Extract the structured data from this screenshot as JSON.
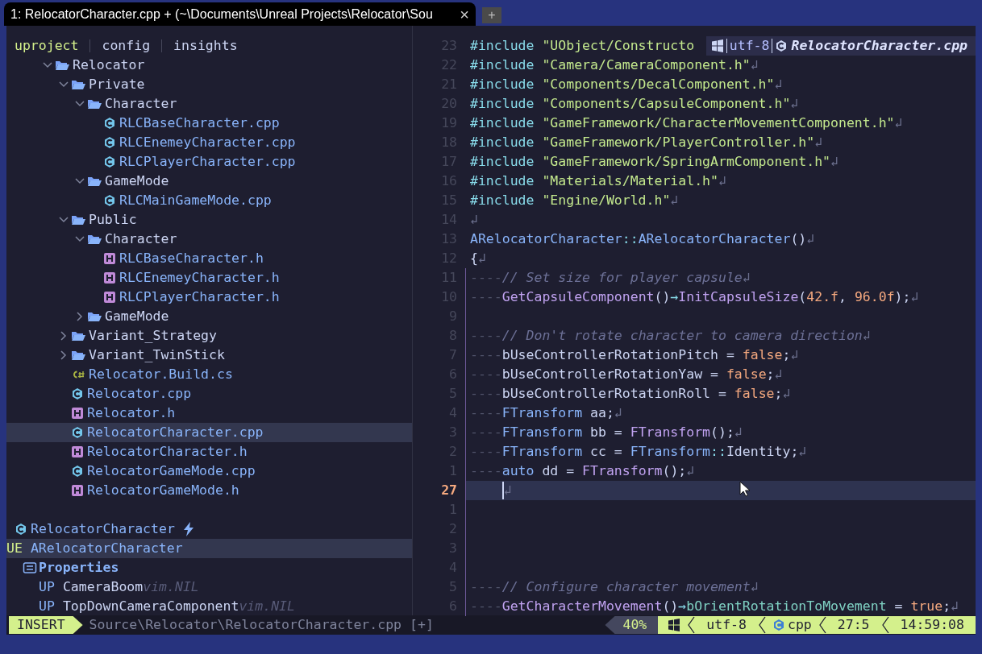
{
  "tab": {
    "title": "1: RelocatorCharacter.cpp + (~\\Documents\\Unreal Projects\\Relocator\\Sou",
    "close": "×",
    "new_tab": "+"
  },
  "explorer": {
    "tabs": [
      {
        "label": "uproject",
        "selected": true
      },
      {
        "label": "config",
        "selected": false
      },
      {
        "label": "insights",
        "selected": false
      }
    ],
    "tree": [
      {
        "name": "Relocator",
        "kind": "folder",
        "expanded": true,
        "selected": false,
        "children": [
          {
            "name": "Private",
            "kind": "folder",
            "expanded": true,
            "selected": false,
            "children": [
              {
                "name": "Character",
                "kind": "folder",
                "expanded": true,
                "selected": false,
                "children": [
                  {
                    "name": "RLCBaseCharacter.cpp",
                    "kind": "cpp",
                    "selected": false
                  },
                  {
                    "name": "RLCEnemeyCharacter.cpp",
                    "kind": "cpp",
                    "selected": false
                  },
                  {
                    "name": "RLCPlayerCharacter.cpp",
                    "kind": "cpp",
                    "selected": false
                  }
                ]
              },
              {
                "name": "GameMode",
                "kind": "folder",
                "expanded": true,
                "selected": false,
                "children": [
                  {
                    "name": "RLCMainGameMode.cpp",
                    "kind": "cpp",
                    "selected": false
                  }
                ]
              }
            ]
          },
          {
            "name": "Public",
            "kind": "folder",
            "expanded": true,
            "selected": false,
            "children": [
              {
                "name": "Character",
                "kind": "folder",
                "expanded": true,
                "selected": false,
                "children": [
                  {
                    "name": "RLCBaseCharacter.h",
                    "kind": "h",
                    "selected": false
                  },
                  {
                    "name": "RLCEnemeyCharacter.h",
                    "kind": "h",
                    "selected": false
                  },
                  {
                    "name": "RLCPlayerCharacter.h",
                    "kind": "h",
                    "selected": false
                  }
                ]
              },
              {
                "name": "GameMode",
                "kind": "folder",
                "expanded": false,
                "selected": false
              }
            ]
          },
          {
            "name": "Variant_Strategy",
            "kind": "folder",
            "expanded": false,
            "selected": false
          },
          {
            "name": "Variant_TwinStick",
            "kind": "folder",
            "expanded": false,
            "selected": false
          },
          {
            "name": "Relocator.Build.cs",
            "kind": "cs",
            "selected": false
          },
          {
            "name": "Relocator.cpp",
            "kind": "cpp",
            "selected": false
          },
          {
            "name": "Relocator.h",
            "kind": "h",
            "selected": false
          },
          {
            "name": "RelocatorCharacter.cpp",
            "kind": "cpp",
            "selected": true
          },
          {
            "name": "RelocatorCharacter.h",
            "kind": "h",
            "selected": false
          },
          {
            "name": "RelocatorGameMode.cpp",
            "kind": "cpp",
            "selected": false
          },
          {
            "name": "RelocatorGameMode.h",
            "kind": "h",
            "selected": false
          }
        ]
      }
    ]
  },
  "outline": {
    "title": "RelocatorCharacter",
    "items": [
      {
        "prefix": "UE",
        "name": "ARelocatorCharacter",
        "kind": "class",
        "selected": true,
        "children": [
          {
            "name": "Properties",
            "kind": "group",
            "selected": false,
            "children": [
              {
                "prefix": "UP",
                "name": "CameraBoom",
                "detail": "vim.NIL",
                "kind": "property",
                "selected": false
              },
              {
                "prefix": "UP",
                "name": "TopDownCameraComponent",
                "detail": "vim.NIL",
                "kind": "property",
                "selected": false
              }
            ]
          }
        ]
      }
    ]
  },
  "winbar": {
    "encoding": "utf-8",
    "file": "RelocatorCharacter.cpp"
  },
  "code": [
    {
      "n": "23",
      "current": false,
      "guide": false,
      "tokens": [
        {
          "kind": "kw",
          "text": "#include "
        },
        {
          "kind": "str",
          "text": "\"UObject/Constructo"
        }
      ]
    },
    {
      "n": "22",
      "current": false,
      "guide": false,
      "tokens": [
        {
          "kind": "kw",
          "text": "#include "
        },
        {
          "kind": "str",
          "text": "\"Camera/CameraComponent.h\""
        },
        {
          "kind": "eol",
          "text": "↲"
        }
      ]
    },
    {
      "n": "21",
      "current": false,
      "guide": false,
      "tokens": [
        {
          "kind": "kw",
          "text": "#include "
        },
        {
          "kind": "str",
          "text": "\"Components/DecalComponent.h\""
        },
        {
          "kind": "eol",
          "text": "↲"
        }
      ]
    },
    {
      "n": "20",
      "current": false,
      "guide": false,
      "tokens": [
        {
          "kind": "kw",
          "text": "#include "
        },
        {
          "kind": "str",
          "text": "\"Components/CapsuleComponent.h\""
        },
        {
          "kind": "eol",
          "text": "↲"
        }
      ]
    },
    {
      "n": "19",
      "current": false,
      "guide": false,
      "tokens": [
        {
          "kind": "kw",
          "text": "#include "
        },
        {
          "kind": "str",
          "text": "\"GameFramework/CharacterMovementComponent.h\""
        },
        {
          "kind": "eol",
          "text": "↲"
        }
      ]
    },
    {
      "n": "18",
      "current": false,
      "guide": false,
      "tokens": [
        {
          "kind": "kw",
          "text": "#include "
        },
        {
          "kind": "str",
          "text": "\"GameFramework/PlayerController.h\""
        },
        {
          "kind": "eol",
          "text": "↲"
        }
      ]
    },
    {
      "n": "17",
      "current": false,
      "guide": false,
      "tokens": [
        {
          "kind": "kw",
          "text": "#include "
        },
        {
          "kind": "str",
          "text": "\"GameFramework/SpringArmComponent.h\""
        },
        {
          "kind": "eol",
          "text": "↲"
        }
      ]
    },
    {
      "n": "16",
      "current": false,
      "guide": false,
      "tokens": [
        {
          "kind": "kw",
          "text": "#include "
        },
        {
          "kind": "str",
          "text": "\"Materials/Material.h\""
        },
        {
          "kind": "eol",
          "text": "↲"
        }
      ]
    },
    {
      "n": "15",
      "current": false,
      "guide": false,
      "tokens": [
        {
          "kind": "kw",
          "text": "#include "
        },
        {
          "kind": "str",
          "text": "\"Engine/World.h\""
        },
        {
          "kind": "eol",
          "text": "↲"
        }
      ]
    },
    {
      "n": "14",
      "current": false,
      "guide": false,
      "tokens": [
        {
          "kind": "eol",
          "text": "↲"
        }
      ]
    },
    {
      "n": "13",
      "current": false,
      "guide": false,
      "tokens": [
        {
          "kind": "type",
          "text": "ARelocatorCharacter"
        },
        {
          "kind": "op",
          "text": "::"
        },
        {
          "kind": "type",
          "text": "ARelocatorCharacter"
        },
        {
          "kind": "punct",
          "text": "()"
        },
        {
          "kind": "eol",
          "text": "↲"
        }
      ]
    },
    {
      "n": "12",
      "current": false,
      "guide": false,
      "tokens": [
        {
          "kind": "plain",
          "text": "{"
        },
        {
          "kind": "eol",
          "text": "↲"
        }
      ]
    },
    {
      "n": "11",
      "current": false,
      "guide": true,
      "tokens": [
        {
          "kind": "ws",
          "text": "----"
        },
        {
          "kind": "comment",
          "text": "// Set size for player capsule"
        },
        {
          "kind": "eol",
          "text": "↲"
        }
      ]
    },
    {
      "n": "10",
      "current": false,
      "guide": true,
      "tokens": [
        {
          "kind": "ws",
          "text": "----"
        },
        {
          "kind": "func",
          "text": "GetCapsuleComponent"
        },
        {
          "kind": "punct",
          "text": "()"
        },
        {
          "kind": "op",
          "text": "→"
        },
        {
          "kind": "func",
          "text": "InitCapsuleSize"
        },
        {
          "kind": "punct",
          "text": "("
        },
        {
          "kind": "num",
          "text": "42.f"
        },
        {
          "kind": "punct",
          "text": ", "
        },
        {
          "kind": "num",
          "text": "96.0f"
        },
        {
          "kind": "punct",
          "text": ");"
        },
        {
          "kind": "eol",
          "text": "↲"
        }
      ]
    },
    {
      "n": "9",
      "current": false,
      "guide": true
    },
    {
      "n": "8",
      "current": false,
      "guide": true,
      "tokens": [
        {
          "kind": "ws",
          "text": "----"
        },
        {
          "kind": "comment",
          "text": "// Don't rotate character to camera direction"
        },
        {
          "kind": "eol",
          "text": "↲"
        }
      ]
    },
    {
      "n": "7",
      "current": false,
      "guide": true,
      "tokens": [
        {
          "kind": "ws",
          "text": "----"
        },
        {
          "kind": "plain",
          "text": "bUseControllerRotationPitch = "
        },
        {
          "kind": "num",
          "text": "false"
        },
        {
          "kind": "punct",
          "text": ";"
        },
        {
          "kind": "eol",
          "text": "↲"
        }
      ]
    },
    {
      "n": "6",
      "current": false,
      "guide": true,
      "tokens": [
        {
          "kind": "ws",
          "text": "----"
        },
        {
          "kind": "plain",
          "text": "bUseControllerRotationYaw = "
        },
        {
          "kind": "num",
          "text": "false"
        },
        {
          "kind": "punct",
          "text": ";"
        },
        {
          "kind": "eol",
          "text": "↲"
        }
      ]
    },
    {
      "n": "5",
      "current": false,
      "guide": true,
      "tokens": [
        {
          "kind": "ws",
          "text": "----"
        },
        {
          "kind": "plain",
          "text": "bUseControllerRotationRoll = "
        },
        {
          "kind": "num",
          "text": "false"
        },
        {
          "kind": "punct",
          "text": ";"
        },
        {
          "kind": "eol",
          "text": "↲"
        }
      ]
    },
    {
      "n": "4",
      "current": false,
      "guide": true,
      "tokens": [
        {
          "kind": "ws",
          "text": "----"
        },
        {
          "kind": "type",
          "text": "FTransform"
        },
        {
          "kind": "plain",
          "text": " aa;"
        },
        {
          "kind": "eol",
          "text": "↲"
        }
      ]
    },
    {
      "n": "3",
      "current": false,
      "guide": true,
      "tokens": [
        {
          "kind": "ws",
          "text": "----"
        },
        {
          "kind": "type",
          "text": "FTransform"
        },
        {
          "kind": "plain",
          "text": " bb = "
        },
        {
          "kind": "func",
          "text": "FTransform"
        },
        {
          "kind": "punct",
          "text": "();"
        },
        {
          "kind": "eol",
          "text": "↲"
        }
      ]
    },
    {
      "n": "2",
      "current": false,
      "guide": true,
      "tokens": [
        {
          "kind": "ws",
          "text": "----"
        },
        {
          "kind": "type",
          "text": "FTransform"
        },
        {
          "kind": "plain",
          "text": " cc = "
        },
        {
          "kind": "type",
          "text": "FTransform"
        },
        {
          "kind": "op",
          "text": "::"
        },
        {
          "kind": "plain",
          "text": "Identity;"
        },
        {
          "kind": "eol",
          "text": "↲"
        }
      ]
    },
    {
      "n": "1",
      "current": false,
      "guide": true,
      "tokens": [
        {
          "kind": "ws",
          "text": "----"
        },
        {
          "kind": "type",
          "text": "auto"
        },
        {
          "kind": "plain",
          "text": " dd = "
        },
        {
          "kind": "func",
          "text": "FTransform"
        },
        {
          "kind": "punct",
          "text": "();"
        },
        {
          "kind": "eol",
          "text": "↲"
        }
      ]
    },
    {
      "n": "27",
      "current": true,
      "guide": true,
      "tokens": [
        {
          "kind": "cursor"
        },
        {
          "kind": "eol",
          "text": "↲"
        }
      ]
    },
    {
      "n": "1",
      "current": false,
      "guide": true
    },
    {
      "n": "2",
      "current": false,
      "guide": true
    },
    {
      "n": "3",
      "current": false,
      "guide": true
    },
    {
      "n": "4",
      "current": false,
      "guide": true
    },
    {
      "n": "5",
      "current": false,
      "guide": true,
      "tokens": [
        {
          "kind": "ws",
          "text": "----"
        },
        {
          "kind": "comment",
          "text": "// Configure character movement"
        },
        {
          "kind": "eol",
          "text": "↲"
        }
      ]
    },
    {
      "n": "6",
      "current": false,
      "guide": true,
      "tokens": [
        {
          "kind": "ws",
          "text": "----"
        },
        {
          "kind": "func",
          "text": "GetCharacterMovement"
        },
        {
          "kind": "punct",
          "text": "()"
        },
        {
          "kind": "op",
          "text": "→"
        },
        {
          "kind": "field",
          "text": "bOrientRotationToMovement"
        },
        {
          "kind": "plain",
          "text": " = "
        },
        {
          "kind": "num",
          "text": "true"
        },
        {
          "kind": "punct",
          "text": ";"
        },
        {
          "kind": "eol",
          "text": "↲"
        }
      ]
    }
  ],
  "status_bar": {
    "mode": "INSERT",
    "path": "Source\\Relocator\\RelocatorCharacter.cpp",
    "modified": "[+]",
    "segments": [
      {
        "kind": "percent",
        "text": "40%"
      },
      {
        "kind": "os"
      },
      {
        "kind": "text",
        "text": "utf-8"
      },
      {
        "kind": "filetype",
        "text": "cpp"
      },
      {
        "kind": "text",
        "text": "27:5"
      },
      {
        "kind": "text",
        "text": "14:59:08"
      }
    ]
  }
}
